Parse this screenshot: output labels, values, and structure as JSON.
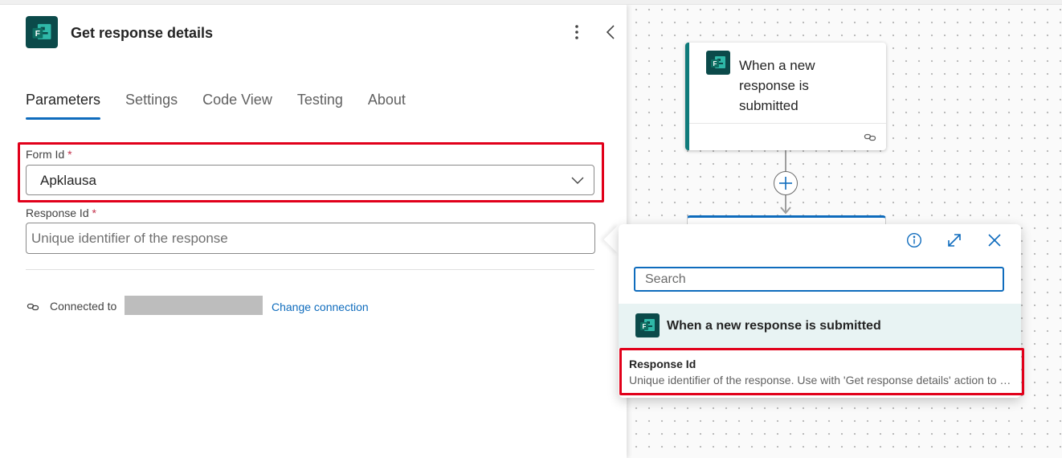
{
  "panel": {
    "title": "Get response details",
    "tabs": [
      {
        "label": "Parameters",
        "active": true
      },
      {
        "label": "Settings",
        "active": false
      },
      {
        "label": "Code View",
        "active": false
      },
      {
        "label": "Testing",
        "active": false
      },
      {
        "label": "About",
        "active": false
      }
    ],
    "form_id": {
      "label": "Form Id",
      "required_mark": "*",
      "value": "Apklausa"
    },
    "response_id": {
      "label": "Response Id",
      "required_mark": "*",
      "placeholder": "Unique identifier of the response",
      "value": ""
    },
    "connection": {
      "label": "Connected to",
      "link": "Change connection"
    }
  },
  "canvas": {
    "trigger_card": {
      "title": "When a new response is submitted"
    }
  },
  "popup": {
    "search_placeholder": "Search",
    "section_title": "When a new response is submitted",
    "item": {
      "title": "Response Id",
      "description": "Unique identifier of the response. Use with 'Get response details' action to get response details."
    }
  },
  "colors": {
    "accent": "#0f6cbd",
    "forms_icon_bg": "#0b4a4a",
    "highlight": "#e1001a",
    "section_bg": "#e8f3f3"
  },
  "icons": [
    "forms-app-icon",
    "more-vertical-icon",
    "chevron-left-icon",
    "chevron-down-icon",
    "link-icon",
    "plus-icon",
    "info-icon",
    "expand-icon",
    "close-icon"
  ]
}
